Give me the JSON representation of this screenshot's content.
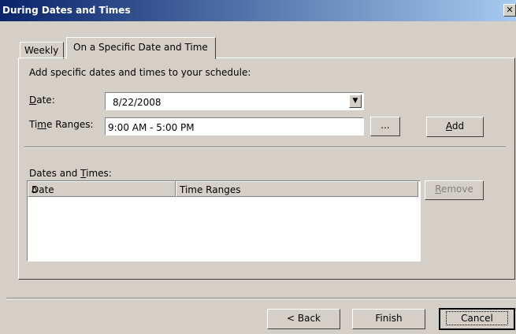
{
  "window": {
    "title": "During Dates and Times",
    "close_glyph": "✕"
  },
  "tabs": [
    {
      "label": "Weekly",
      "selected": false
    },
    {
      "label": "On a Specific Date and Time",
      "selected": true
    }
  ],
  "panel": {
    "instruction": "Add specific dates and times to your schedule:",
    "date_label_prefix": "D",
    "date_label_rest": "ate:",
    "date_value": "8/22/2008",
    "dropdown_glyph": "▼",
    "time_label_prefix": "Ti",
    "time_label_mn": "m",
    "time_label_rest": "e Ranges:",
    "time_value": "9:00 AM - 5:00 PM",
    "browse_label": "...",
    "add_label_u": "A",
    "add_label_rest": "dd",
    "dates_times_prefix": "Dates and ",
    "dates_times_mn": "T",
    "dates_times_rest": "imes:",
    "columns": [
      {
        "label": "Date"
      },
      {
        "label": "Time Ranges"
      }
    ],
    "sort_icon": "sort-ascending-icon",
    "sort_glyph": "Δ",
    "remove_label_u": "R",
    "remove_label_rest": "emove"
  },
  "footer": {
    "back_label": "< Back",
    "finish_label": "Finish",
    "cancel_label": "Cancel"
  }
}
